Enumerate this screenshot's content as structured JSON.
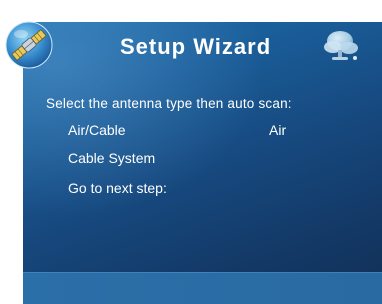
{
  "header": {
    "title": "Setup Wizard",
    "left_icon": "satellite-icon",
    "right_icon": "globe-icon"
  },
  "instruction": "Select the antenna type then auto scan:",
  "menu": {
    "items": [
      {
        "label": "Air/Cable",
        "value": "Air"
      },
      {
        "label": "Cable System",
        "value": ""
      },
      {
        "label": "Go to next step:",
        "value": ""
      }
    ]
  },
  "colors": {
    "panel_top": "#1f6fae",
    "panel_bottom": "#113055",
    "text": "#ffffff",
    "footer": "#2b6fa8"
  }
}
